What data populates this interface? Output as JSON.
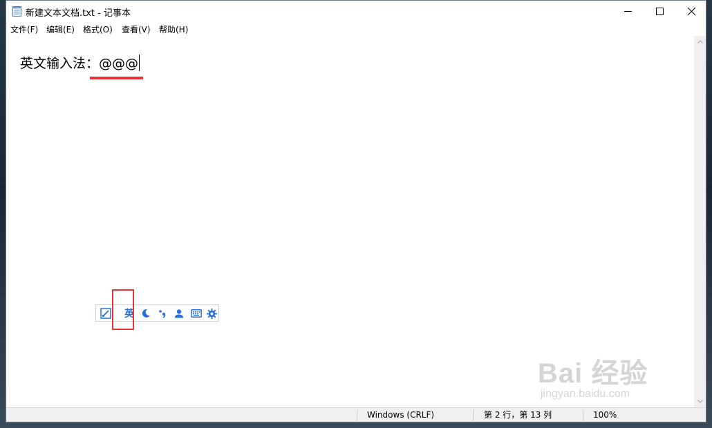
{
  "window": {
    "title": "新建文本文档.txt - 记事本",
    "controls": {
      "minimize": "minimize-icon",
      "maximize": "maximize-icon",
      "close": "close-icon"
    }
  },
  "menu": [
    {
      "label": "文件(F)"
    },
    {
      "label": "编辑(E)"
    },
    {
      "label": "格式(O)"
    },
    {
      "label": "查看(V)"
    },
    {
      "label": "帮助(H)"
    }
  ],
  "editor": {
    "content": "英文输入法：@@@"
  },
  "status": {
    "line_ending": "Windows (CRLF)",
    "position": "第 2 行，第 13 列",
    "zoom": "100%"
  },
  "ime_toolbar": {
    "items": [
      "brush-icon",
      "英",
      "moon-icon",
      "punctuation-icon",
      "user-icon",
      "keyboard-icon",
      "gear-icon"
    ],
    "mode_label": "英"
  },
  "watermark": {
    "main": "Bai 经验",
    "sub": "jingyan.baidu.com"
  },
  "colors": {
    "accent": "#2a6fd6",
    "highlight": "#e8323a"
  }
}
